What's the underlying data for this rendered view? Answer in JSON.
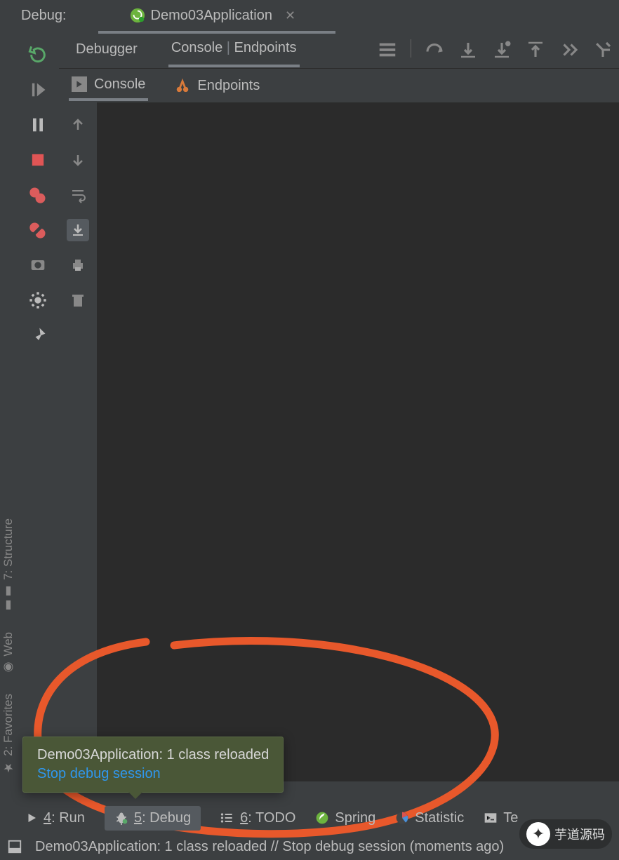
{
  "header": {
    "label": "Debug:",
    "app_tab": "Demo03Application"
  },
  "left_gutter": {
    "favorites": "2: Favorites",
    "web": "Web",
    "structure": "7: Structure"
  },
  "panel_tabs": {
    "debugger": "Debugger",
    "console_endpoints_left": "Console",
    "console_endpoints_sep": " | ",
    "console_endpoints_right": "Endpoints"
  },
  "sub_tabs": {
    "console": "Console",
    "endpoints": "Endpoints"
  },
  "popup": {
    "title": "Demo03Application: 1 class reloaded",
    "link": "Stop debug session"
  },
  "bottom_tabs": {
    "run": "4: Run",
    "debug_pre": "5",
    "debug_post": ": Debug",
    "todo_pre": "6",
    "todo_post": ": TODO",
    "spring": "Spring",
    "statistic": "Statistic",
    "terminal": "Te"
  },
  "status_bar": "Demo03Application: 1 class reloaded // Stop debug session (moments ago)",
  "watermark": "芋道源码",
  "icons": {
    "spring": "spring-boot-icon",
    "close": "close-icon"
  }
}
